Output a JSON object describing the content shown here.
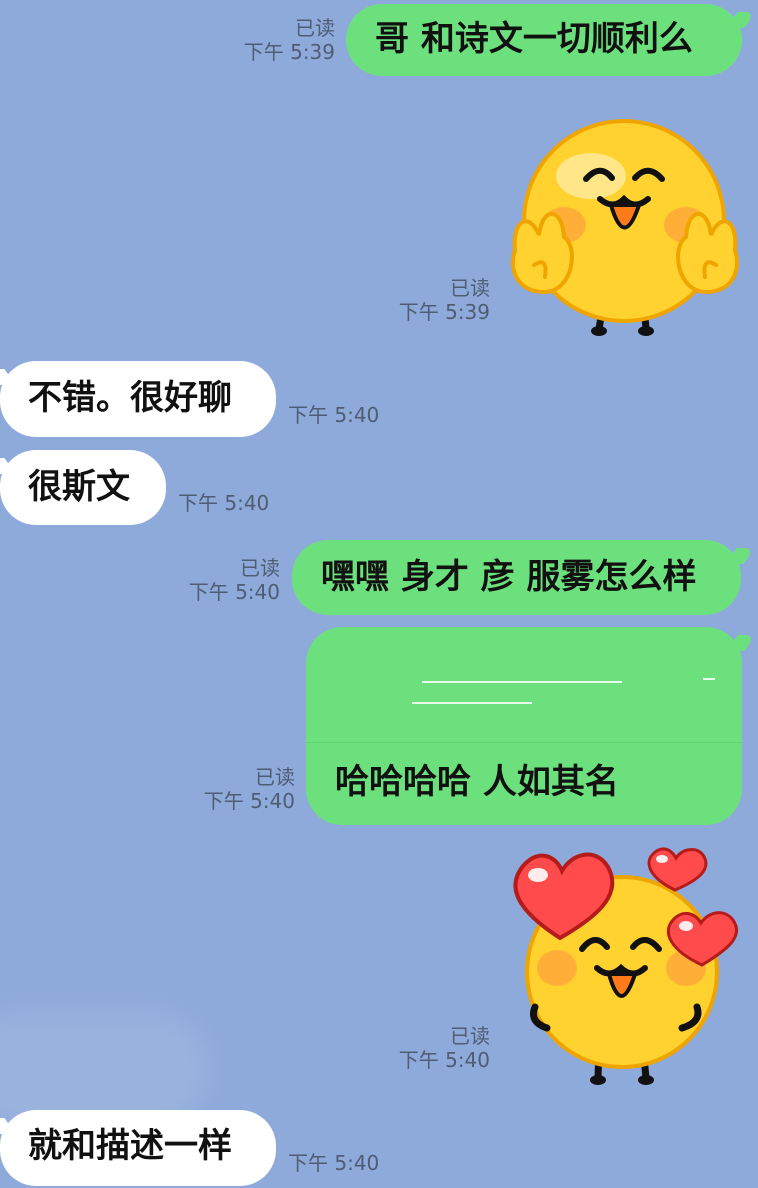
{
  "messages": [
    {
      "read": "已读",
      "time": "下午 5:39",
      "text": "哥 和诗文一切顺利么"
    },
    {
      "read": "已读",
      "time": "下午 5:39",
      "sticker_name": "yellow-peace-sign-sticker"
    },
    {
      "time": "下午 5:40",
      "text": "不错。很好聊"
    },
    {
      "time": "下午 5:40",
      "text": "很斯文"
    },
    {
      "read": "已读",
      "time": "下午 5:40",
      "text": "嘿嘿 身才 彦 服雾怎么样"
    },
    {
      "read": "已读",
      "time": "下午 5:40",
      "text": "哈哈哈哈 人如其名"
    },
    {
      "read": "已读",
      "time": "下午 5:40",
      "sticker_name": "yellow-hearts-sticker"
    },
    {
      "time": "下午 5:40",
      "text": "就和描述一样"
    }
  ],
  "colors": {
    "background": "#8eaadb",
    "outgoing_bubble": "#6de07e",
    "incoming_bubble": "#ffffff",
    "meta_text": "#4f5d73",
    "sticker_yellow": "#ffd22f",
    "heart_red": "#ff4b4b"
  }
}
